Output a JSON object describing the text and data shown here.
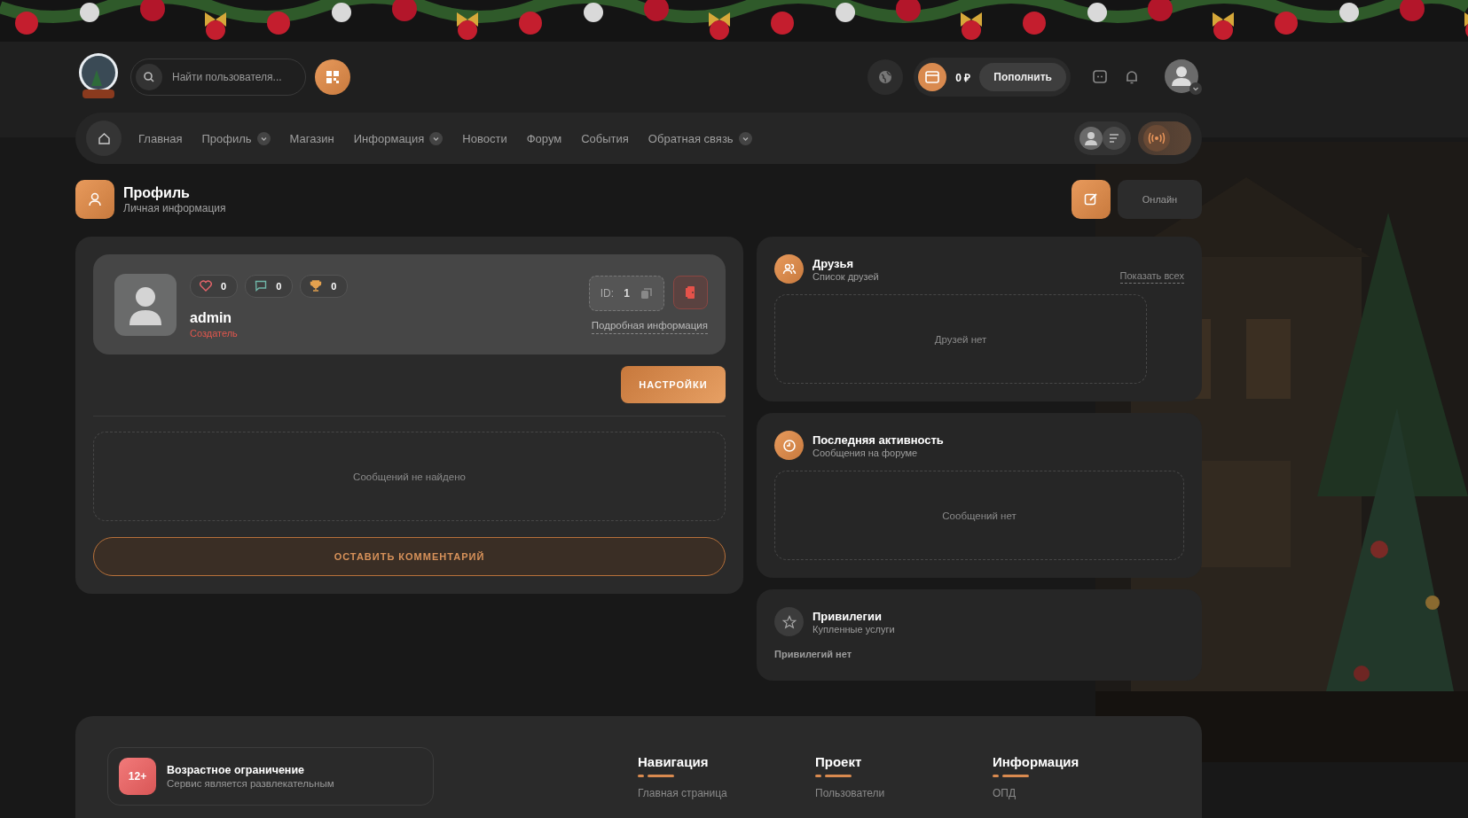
{
  "header": {
    "search": {
      "placeholder": "Найти пользователя..."
    },
    "balance": "0 ₽",
    "topup_button": "Пополнить"
  },
  "nav": {
    "items": [
      {
        "label": "Главная",
        "has_menu": false
      },
      {
        "label": "Профиль",
        "has_menu": true
      },
      {
        "label": "Магазин",
        "has_menu": false
      },
      {
        "label": "Информация",
        "has_menu": true
      },
      {
        "label": "Новости",
        "has_menu": false
      },
      {
        "label": "Форум",
        "has_menu": false
      },
      {
        "label": "События",
        "has_menu": false
      },
      {
        "label": "Обратная связь",
        "has_menu": true
      }
    ],
    "view_options": [
      {
        "kind": "user",
        "selected": true
      },
      {
        "kind": "list",
        "selected": false
      }
    ],
    "live_button": {
      "active": true
    }
  },
  "page_header": {
    "title": "Профиль",
    "subtitle": "Личная информация",
    "status": "Онлайн"
  },
  "profile": {
    "stats": [
      {
        "kind": "likes",
        "value": "0"
      },
      {
        "kind": "comments",
        "value": "0"
      },
      {
        "kind": "trophies",
        "value": "0"
      }
    ],
    "name": "admin",
    "role": "Создатель",
    "id_label": "ID:",
    "id": "1",
    "details_link": "Подробная информация",
    "settings_button": "НАСТРОЙКИ",
    "empty": "Сообщений не найдено",
    "comment_button": "ОСТАВИТЬ КОММЕНТАРИЙ"
  },
  "side_cards": [
    {
      "kind": "friends",
      "title": "Друзья",
      "subtitle": "Список друзей",
      "action": "Показать всех",
      "empty": "Друзей нет"
    },
    {
      "kind": "activity",
      "title": "Последняя активность",
      "subtitle": "Сообщения на форуме",
      "empty": "Сообщений нет"
    },
    {
      "kind": "privileges",
      "title": "Привилегии",
      "subtitle": "Купленные услуги",
      "empty": "Привилегий нет"
    }
  ],
  "footer": {
    "age": {
      "badge": "12+",
      "title": "Возрастное ограничение",
      "subtitle": "Сервис является развлекательным"
    },
    "columns": [
      {
        "title": "Навигация",
        "links": [
          "Главная страница"
        ]
      },
      {
        "title": "Проект",
        "links": [
          "Пользователи"
        ]
      },
      {
        "title": "Информация",
        "links": [
          "ОПД"
        ]
      }
    ]
  }
}
